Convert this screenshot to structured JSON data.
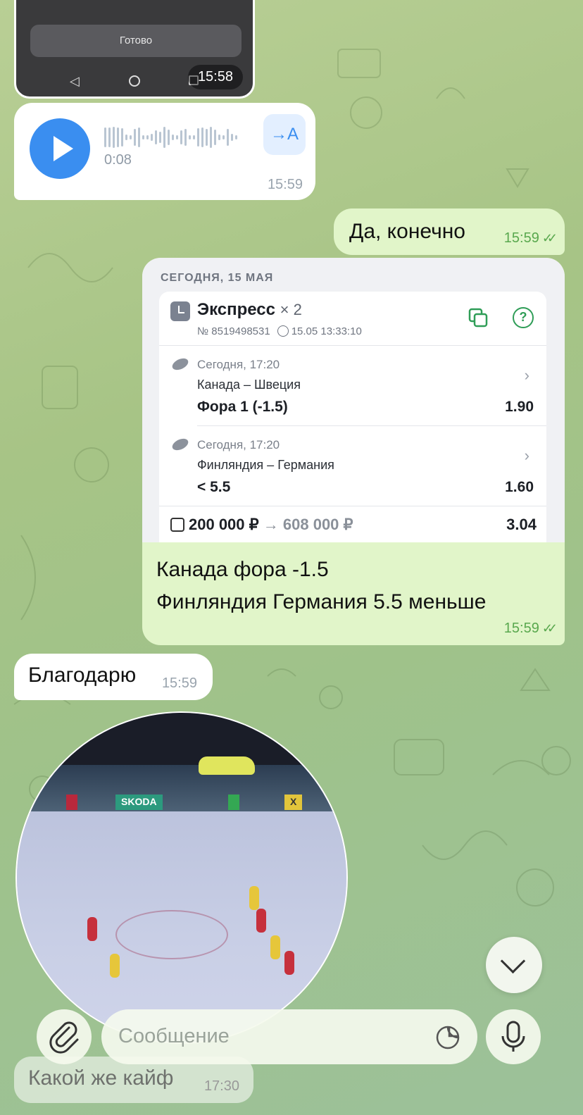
{
  "chat": {
    "image_message": {
      "button_label": "Готово",
      "time": "15:58"
    },
    "voice_message": {
      "duration": "0:08",
      "time": "15:59",
      "transcribe_label": "→A"
    },
    "outgoing_1": {
      "text": "Да, конечно",
      "time": "15:59"
    },
    "bet_message": {
      "date_header": "СЕГОДНЯ, 15 МАЯ",
      "title": "Экспресс",
      "multiplier": "× 2",
      "number": "№ 8519498531",
      "created": "15.05 13:33:10",
      "events": [
        {
          "when": "Сегодня, 17:20",
          "teams": "Канада – Швеция",
          "pick": "Фора 1 (-1.5)",
          "odd": "1.90"
        },
        {
          "when": "Сегодня, 17:20",
          "teams": "Финляндия – Германия",
          "pick": "< 5.5",
          "odd": "1.60"
        }
      ],
      "stake": "200 000 ₽",
      "arrow": "→",
      "payout": "608 000 ₽",
      "total_odd": "3.04",
      "caption_line1": "Канада фора -1.5",
      "caption_line2": "Финляндия Германия 5.5 меньше",
      "time": "15:59"
    },
    "incoming_1": {
      "text": "Благодарю",
      "time": "15:59"
    },
    "round_video": {
      "ads": [
        "SKODA",
        "X"
      ]
    },
    "ghost_message": {
      "text": "Какой же кайф",
      "time": "17:30"
    }
  },
  "composer": {
    "placeholder": "Сообщение"
  },
  "icons": {
    "attach": "paperclip-icon",
    "sticker": "sticker-icon",
    "mic": "microphone-icon",
    "scroll": "chevron-down-icon",
    "play": "play-icon"
  },
  "colors": {
    "accent": "#3a8ef0",
    "outgoing_bubble": "#e1f5c9",
    "check_green": "#59a84e",
    "bet_green": "#2f9d57"
  }
}
